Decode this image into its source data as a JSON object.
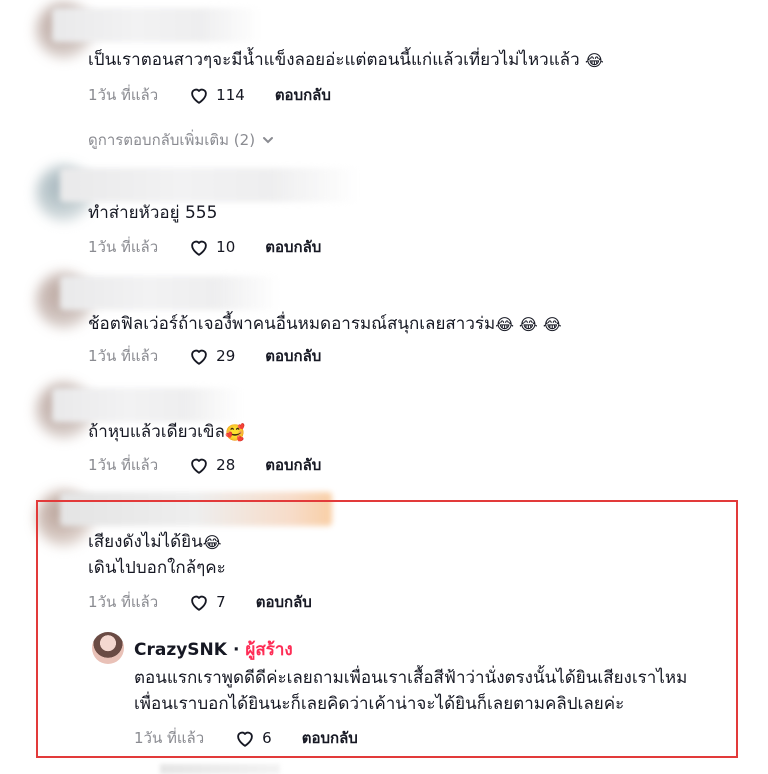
{
  "reply_action_label": "ตอบกลับ",
  "time_label": "1วัน ที่แล้ว",
  "comments": [
    {
      "text": "เป็นเราตอนสาวๆจะมีน้ำแข็งลอยอ่ะแต่ตอนนี้แก่แล้วเที่ยวไม่ไหวแล้ว",
      "emoji": "😂",
      "likes": "114"
    },
    {
      "text": "ทำส่ายหัวอยู่ 555",
      "emoji": "",
      "likes": "10"
    },
    {
      "text": "ช้อตฟิลเว่อร์ถ้าเจองี้พาคนอื่นหมดอารมณ์สนุกเลยสาวร่ม",
      "emoji": "😂 😂 😂",
      "likes": "29"
    },
    {
      "text": "ถ้าหุบแล้วเดียวเขิล",
      "emoji": "🥰",
      "likes": "28"
    },
    {
      "text": "เสียงดังไม่ได้ยิน",
      "emoji": "😂",
      "text2": "เดินไปบอกใกล้ๆคะ",
      "likes": "7"
    }
  ],
  "view_more_replies": "ดูการตอบกลับเพิ่มเติม (2)",
  "creator_reply": {
    "author": "CrazySNK",
    "separator": "·",
    "badge": "ผู้สร้าง",
    "line1": "ตอนแรกเราพูดดีดีค่ะเลยถามเพื่อนเราเสื้อสีฟ้าว่านั่งตรงนั้นได้ยินเสียงเราไหม",
    "line2": "เพื่อนเราบอกได้ยินนะก็เลยคิดว่าเค้าน่าจะได้ยินก็เลยตามคลิปเลยค่ะ",
    "likes": "6"
  },
  "colors": {
    "highlight_border": "#e23a3a",
    "creator_badge": "#fe2c55",
    "muted": "#8a8b91"
  }
}
